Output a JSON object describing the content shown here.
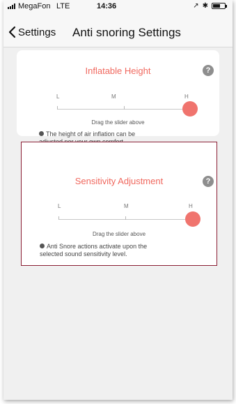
{
  "status_bar": {
    "carrier": "MegaFon",
    "network": "LTE",
    "time": "14:36",
    "icons": [
      "location-icon",
      "bluetooth-icon",
      "battery-icon"
    ]
  },
  "nav": {
    "back_label": "Settings",
    "title": "Anti snoring Settings"
  },
  "cards": [
    {
      "title": "Inflatable Height",
      "help": "?",
      "levels": [
        "L",
        "M",
        "H"
      ],
      "selected_level": "H",
      "hint": "Drag the slider above",
      "note_line1": "The height of air inflation can be",
      "note_line2": "adjusted per your own comfort."
    },
    {
      "title": "Sensitivity Adjustment",
      "help": "?",
      "levels": [
        "L",
        "M",
        "H"
      ],
      "selected_level": "H",
      "hint": "Drag the slider above",
      "note_line1": "Anti Snore actions activate upon the",
      "note_line2": "selected sound sensitivity level."
    }
  ],
  "colors": {
    "accent": "#f0685e",
    "highlight_border": "#8a1d33",
    "background": "#f0f0f0"
  }
}
